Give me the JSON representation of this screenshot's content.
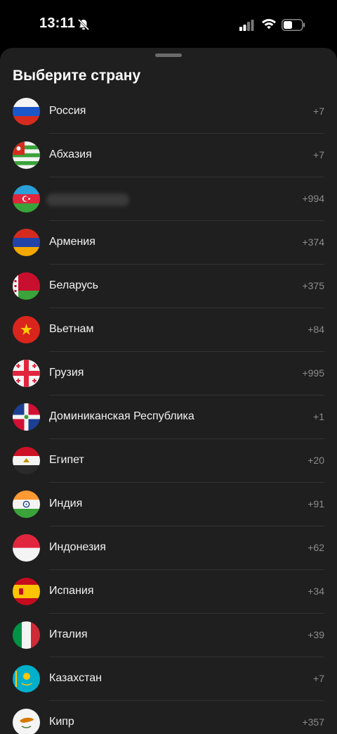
{
  "status_bar": {
    "time": "13:11",
    "icons": [
      "bell-slash-icon",
      "signal-icon",
      "wifi-icon",
      "battery-icon"
    ]
  },
  "sheet": {
    "title": "Выберите страну"
  },
  "countries": [
    {
      "name": "Россия",
      "code": "+7",
      "flag": "russia-flag-icon"
    },
    {
      "name": "Абхазия",
      "code": "+7",
      "flag": "abkhazia-flag-icon"
    },
    {
      "name": "",
      "code": "+994",
      "flag": "azerbaijan-flag-icon",
      "name_blurred": true
    },
    {
      "name": "Армения",
      "code": "+374",
      "flag": "armenia-flag-icon"
    },
    {
      "name": "Беларусь",
      "code": "+375",
      "flag": "belarus-flag-icon"
    },
    {
      "name": "Вьетнам",
      "code": "+84",
      "flag": "vietnam-flag-icon"
    },
    {
      "name": "Грузия",
      "code": "+995",
      "flag": "georgia-flag-icon"
    },
    {
      "name": "Доминиканская Республика",
      "code": "+1",
      "flag": "dominican-republic-flag-icon"
    },
    {
      "name": "Египет",
      "code": "+20",
      "flag": "egypt-flag-icon"
    },
    {
      "name": "Индия",
      "code": "+91",
      "flag": "india-flag-icon"
    },
    {
      "name": "Индонезия",
      "code": "+62",
      "flag": "indonesia-flag-icon"
    },
    {
      "name": "Испания",
      "code": "+34",
      "flag": "spain-flag-icon"
    },
    {
      "name": "Италия",
      "code": "+39",
      "flag": "italy-flag-icon"
    },
    {
      "name": "Казахстан",
      "code": "+7",
      "flag": "kazakhstan-flag-icon"
    },
    {
      "name": "Кипр",
      "code": "+357",
      "flag": "cyprus-flag-icon"
    }
  ],
  "colors": {
    "sheet_background": "#1f1f1f",
    "screen_background": "#000000",
    "code_text": "#8c8c8c",
    "divider": "#333333"
  }
}
